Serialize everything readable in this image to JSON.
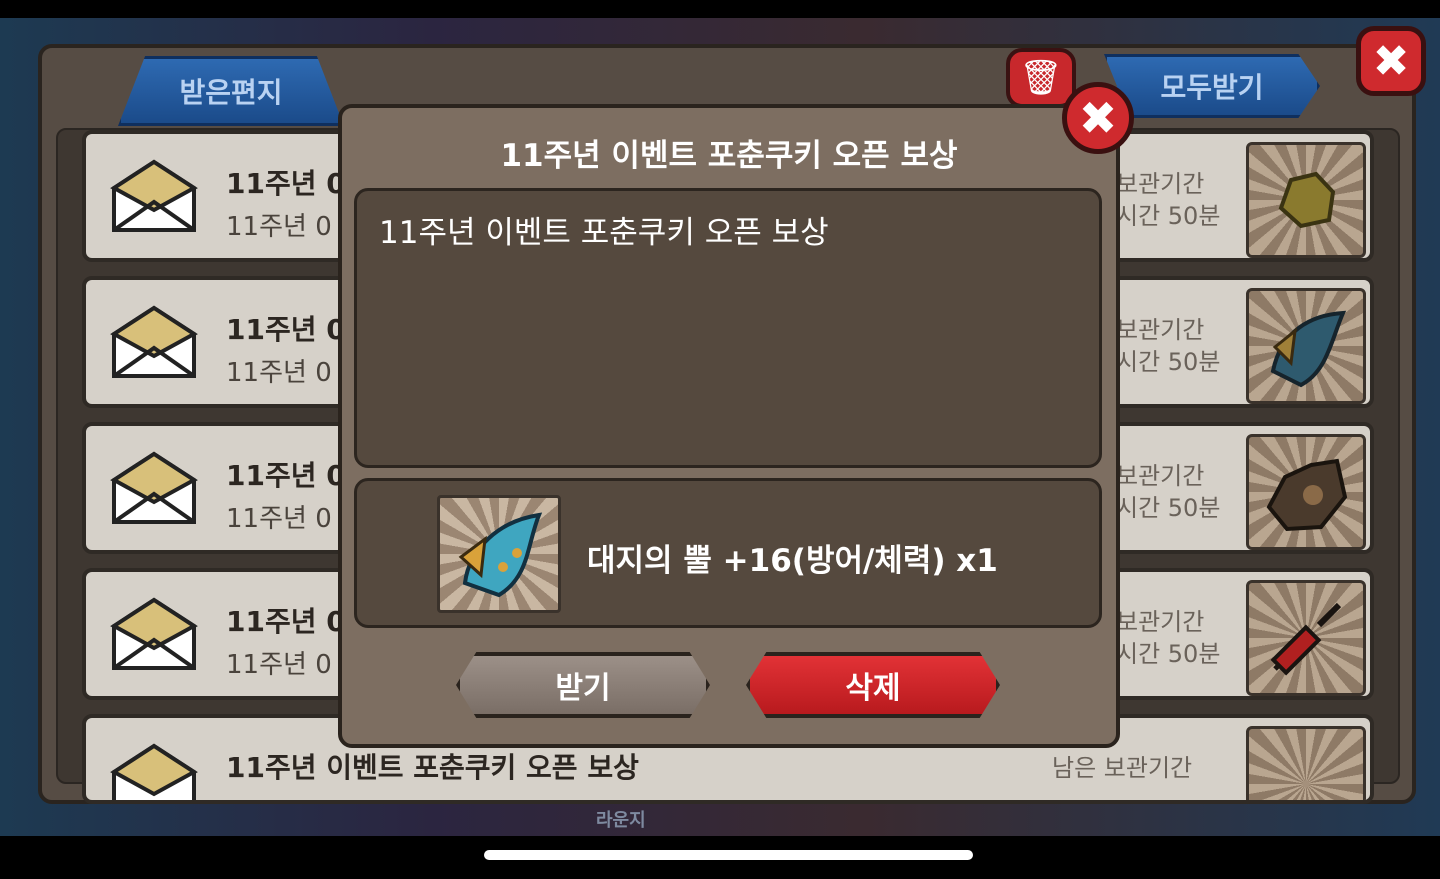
{
  "tabs": {
    "received": "받은편지",
    "receive_all": "모두받기"
  },
  "icons": {
    "trash": "trash-icon",
    "close": "close-icon",
    "envelope": "envelope-icon"
  },
  "mail_rows": [
    {
      "title": "11주년 0",
      "subtitle": "11주년 0",
      "keep_line1": "보관기간",
      "keep_line2": "시간 50분"
    },
    {
      "title": "11주년 0",
      "subtitle": "11주년 0",
      "keep_line1": "보관기간",
      "keep_line2": "시간 50분"
    },
    {
      "title": "11주년 0",
      "subtitle": "11주년 0",
      "keep_line1": "보관기간",
      "keep_line2": "시간 50분"
    },
    {
      "title": "11주년 0",
      "subtitle": "11주년 0",
      "keep_line1": "보관기간",
      "keep_line2": "시간 50분"
    },
    {
      "title": "11주년 이벤트 포춘쿠키 오픈 보상",
      "subtitle": "",
      "keep_line1": "남은 보관기간",
      "keep_line2": ""
    }
  ],
  "dialog": {
    "title": "11주년 이벤트 포춘쿠키 오픈 보상",
    "message": "11주년 이벤트 포춘쿠키 오픈 보상",
    "reward": "대지의 뿔 +16(방어/체력) x1",
    "receive_button": "받기",
    "delete_button": "삭제"
  },
  "background": {
    "lobby_label": "라운지"
  },
  "colors": {
    "accent_red": "#cf2a2e",
    "tab_blue": "#1b4b8a"
  }
}
